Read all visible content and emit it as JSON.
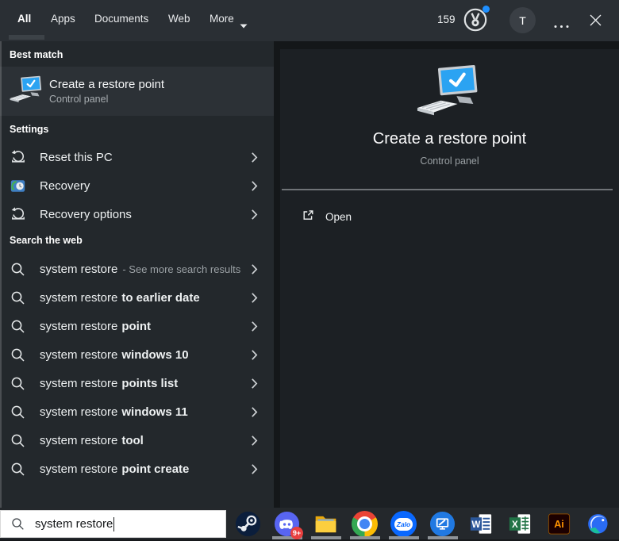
{
  "topbar": {
    "tabs": [
      "All",
      "Apps",
      "Documents",
      "Web",
      "More"
    ],
    "selected_tab": "All",
    "rewards_points": "159",
    "avatar_initial": "T"
  },
  "left": {
    "best_match_header": "Best match",
    "best_match": {
      "title": "Create a restore point",
      "subtitle": "Control panel"
    },
    "settings_header": "Settings",
    "settings": [
      {
        "label": "Reset this PC",
        "icon": "reset-pc-icon"
      },
      {
        "label": "Recovery",
        "icon": "recovery-icon"
      },
      {
        "label": "Recovery options",
        "icon": "reset-pc-icon"
      }
    ],
    "web_header": "Search the web",
    "web_primary": {
      "query": "system restore",
      "note": "- See more search results"
    },
    "web_suggestions": [
      {
        "query": "system restore",
        "completion": "to earlier date"
      },
      {
        "query": "system restore",
        "completion": "point"
      },
      {
        "query": "system restore",
        "completion": "windows 10"
      },
      {
        "query": "system restore",
        "completion": "points list"
      },
      {
        "query": "system restore",
        "completion": "windows 11"
      },
      {
        "query": "system restore",
        "completion": "tool"
      },
      {
        "query": "system restore",
        "completion": "point create"
      }
    ]
  },
  "preview": {
    "title": "Create a restore point",
    "subtitle": "Control panel",
    "open_label": "Open"
  },
  "search_box": {
    "value": "system restore"
  },
  "taskbar": {
    "discord_badge": "9+",
    "icons": [
      "steam",
      "discord",
      "file-explorer",
      "chrome",
      "zalo",
      "ultraviewer",
      "word",
      "excel",
      "illustrator",
      "coccoc"
    ],
    "running_icons": [
      "discord",
      "file-explorer",
      "chrome",
      "zalo",
      "ultraviewer"
    ],
    "logo_letters": {
      "word": "W",
      "excel": "X",
      "illustrator": "Ai",
      "zalo": "Zalo"
    }
  },
  "colors": {
    "accent_blue": "#2ba3f2",
    "badge_red": "#e8403f",
    "notification_blue": "#1e8fff",
    "word_blue": "#2b579a",
    "excel_green": "#217346",
    "discord_purple": "#5865f2"
  }
}
